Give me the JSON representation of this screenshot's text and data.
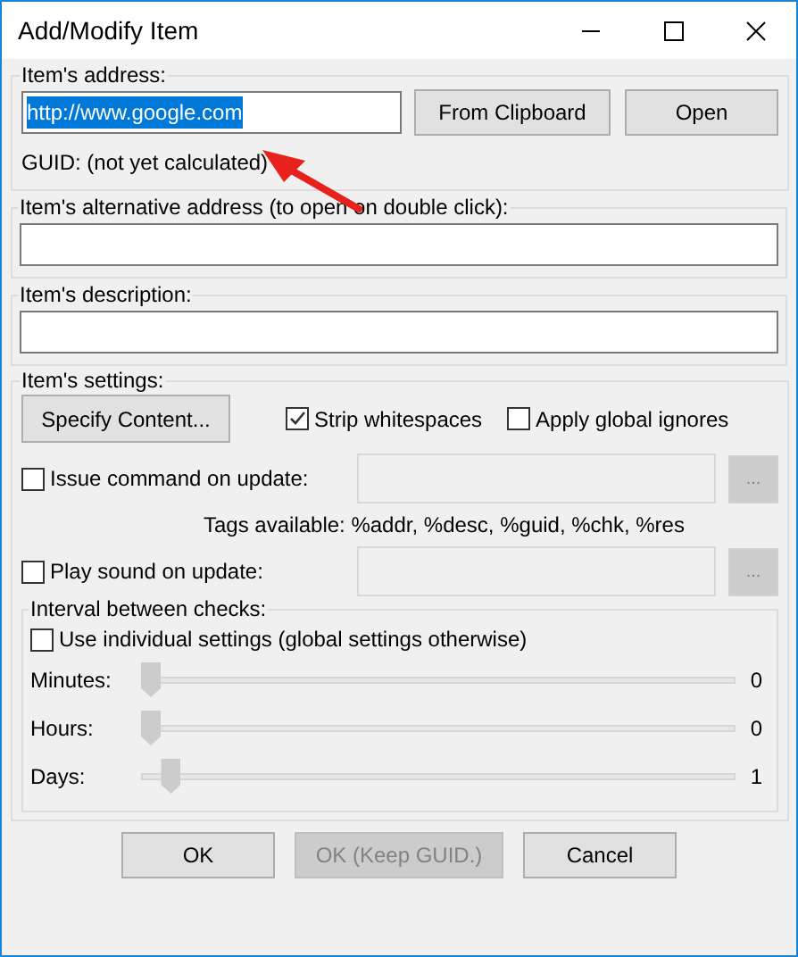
{
  "window": {
    "title": "Add/Modify Item"
  },
  "address": {
    "label": "Item's address:",
    "value": "http://www.google.com",
    "value_selected": true,
    "buttons": [
      "From Clipboard",
      "Open"
    ],
    "guid": "GUID: (not yet calculated)"
  },
  "alt_address": {
    "label": "Item's alternative address (to open on double click):"
  },
  "description": {
    "label": "Item's description:"
  },
  "settings": {
    "label": "Item's settings:",
    "specify_button": "Specify Content...",
    "options": [
      {
        "label": "Strip whitespaces",
        "checked": true
      },
      {
        "label": "Apply global ignores",
        "checked": false
      }
    ],
    "commands": [
      {
        "label": "Issue command on update:",
        "checked": false,
        "browse": "..."
      },
      {
        "label": "Play sound on update:",
        "checked": false,
        "browse": "..."
      }
    ],
    "tags_note": "Tags available: %addr, %desc, %guid, %chk, %res",
    "interval": {
      "label": "Interval between checks:",
      "individual": {
        "label": "Use individual settings (global settings otherwise)",
        "checked": false
      },
      "sliders": [
        {
          "label": "Minutes:",
          "level": 0,
          "reading": "0"
        },
        {
          "label": "Hours:",
          "level": 0,
          "reading": "0"
        },
        {
          "label": "Days:",
          "level": 0.035,
          "reading": "1"
        }
      ]
    }
  },
  "buttons": [
    {
      "label": "OK",
      "disabled": false
    },
    {
      "label": "OK (Keep GUID.)",
      "disabled": true
    },
    {
      "label": "Cancel",
      "disabled": false
    }
  ]
}
